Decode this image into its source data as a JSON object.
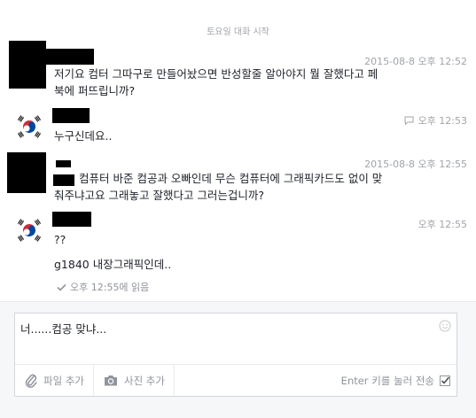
{
  "divider": "토요일 대화 시작",
  "messages": [
    {
      "timestamp": "2015-08-8 오후 12:52",
      "lines": [
        "저기요 컴터 그따구로 만들어놨으면 반성할줄 알아야지 뭘 잘했다고 페",
        "북에 퍼뜨립니까?"
      ]
    },
    {
      "timestamp": "오후 12:53",
      "lines": [
        "누구신데요.."
      ]
    },
    {
      "timestamp": "2015-08-8 오후 12:55",
      "lines": [
        "컴퓨터 바준 컴공과 오빠인데 무슨 컴퓨터에 그래픽카드도 없이 맞",
        "춰주냐고요 그래놓고 잘했다고 그러는겁니까?"
      ]
    },
    {
      "timestamp": "오후 12:55",
      "lines": [
        "??",
        "g1840 내장그래픽인데.."
      ]
    }
  ],
  "read_receipt": "오후 12:55에 읽음",
  "composer": {
    "text": "너......컴공 맞냐...",
    "attach_file": "파일 추가",
    "add_photo": "사진 추가",
    "enter_to_send": "Enter 키를 눌러 전송"
  },
  "colors": {
    "flag_red": "#cd2e3a",
    "flag_blue": "#0047a0",
    "muted": "#a0a4ab"
  }
}
